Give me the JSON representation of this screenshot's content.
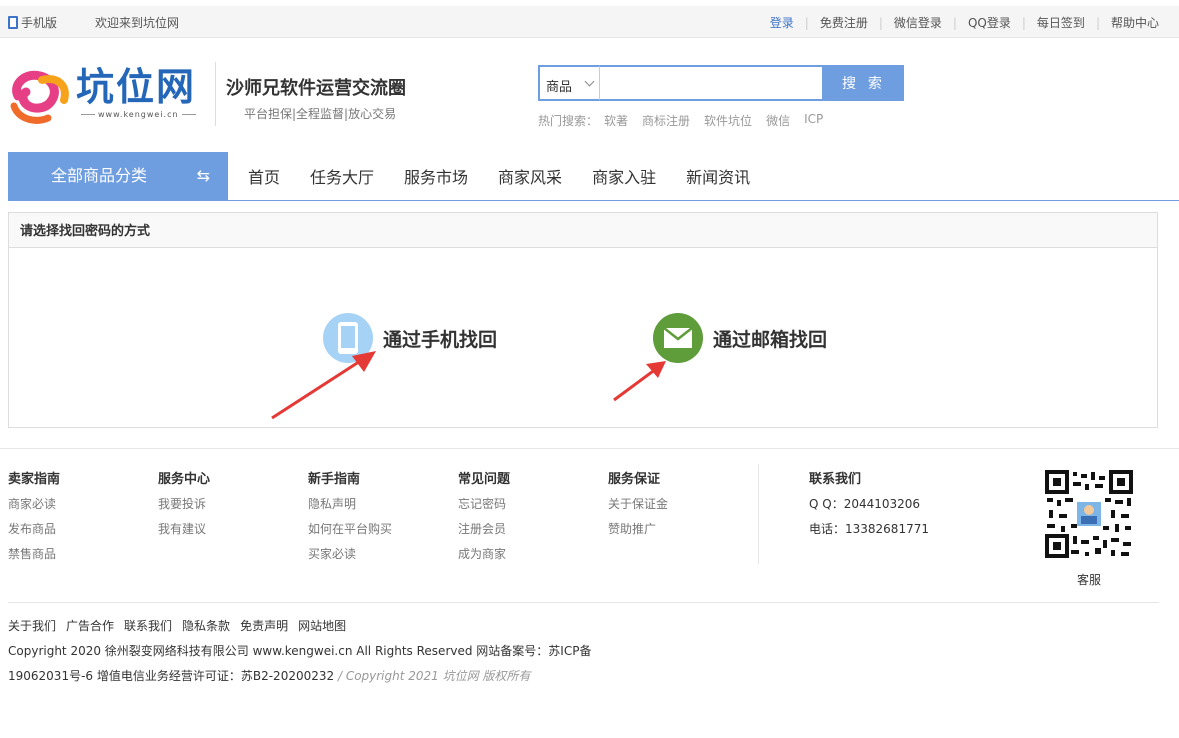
{
  "topbar": {
    "mobile": "手机版",
    "welcome": "欢迎来到坑位网",
    "links": [
      "登录",
      "免费注册",
      "微信登录",
      "QQ登录",
      "每日签到",
      "帮助中心"
    ]
  },
  "header": {
    "logo_text": "坑位网",
    "logo_sub": "www.kengwei.cn",
    "site_name": "沙师兄软件运营交流圈",
    "slogan": "平台担保|全程监督|放心交易",
    "search": {
      "category": "商品",
      "placeholder": "",
      "button": "搜 索"
    },
    "hot": {
      "label": "热门搜索：",
      "items": [
        "软著",
        "商标注册",
        "软件坑位",
        "微信",
        "ICP"
      ]
    }
  },
  "nav": {
    "all_categories": "全部商品分类",
    "swap_glyph": "⇆",
    "items": [
      "首页",
      "任务大厅",
      "服务市场",
      "商家风采",
      "商家入驻",
      "新闻资讯"
    ]
  },
  "panel": {
    "title": "请选择找回密码的方式",
    "phone_option": "通过手机找回",
    "email_option": "通过邮箱找回"
  },
  "footer": {
    "columns": [
      {
        "title": "卖家指南",
        "links": [
          "商家必读",
          "发布商品",
          "禁售商品"
        ]
      },
      {
        "title": "服务中心",
        "links": [
          "我要投诉",
          "我有建议"
        ]
      },
      {
        "title": "新手指南",
        "links": [
          "隐私声明",
          "如何在平台购买",
          "买家必读"
        ]
      },
      {
        "title": "常见问题",
        "links": [
          "忘记密码",
          "注册会员",
          "成为商家"
        ]
      },
      {
        "title": "服务保证",
        "links": [
          "关于保证金",
          "赞助推广"
        ]
      }
    ],
    "contact": {
      "title": "联系我们",
      "qq": "Q Q：2044103206",
      "phone": "电话：13382681771"
    },
    "qr_label": "客服",
    "bottom_links": [
      "关于我们",
      "广告合作",
      "联系我们",
      "隐私条款",
      "免责声明",
      "网站地图"
    ],
    "copyright1": "Copyright 2020 徐州裂变网络科技有限公司 www.kengwei.cn All Rights Reserved 网站备案号：苏ICP备",
    "copyright2a": "19062031号-6 增值电信业务经营许可证：苏B2-20200232",
    "copyright2b": " / Copyright 2021 坑位网 版权所有"
  },
  "colors": {
    "accent": "#6e9de0",
    "brand": "#2466b8",
    "phone_circle": "#a6d3f5",
    "email_circle": "#5f9c3a",
    "arrow": "#e53935"
  },
  "icons": {
    "phone": "mobile-phone-icon",
    "email": "envelope-icon",
    "swap": "swap-arrows-icon"
  }
}
